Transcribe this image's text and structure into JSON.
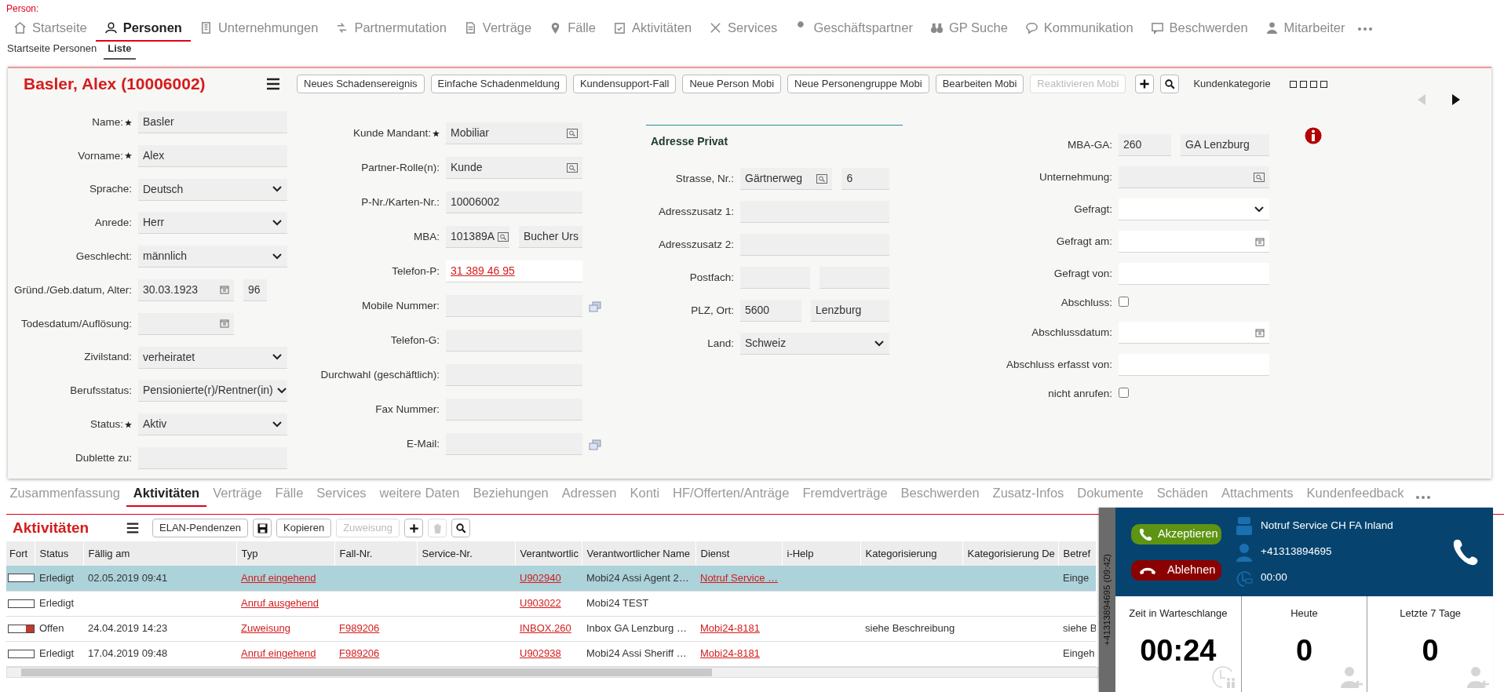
{
  "header": {
    "label": "Person:"
  },
  "main_nav": [
    {
      "label": "Startseite",
      "selected": false
    },
    {
      "label": "Personen",
      "selected": true
    },
    {
      "label": "Unternehmungen",
      "selected": false
    },
    {
      "label": "Partnermutation",
      "selected": false
    },
    {
      "label": "Verträge",
      "selected": false
    },
    {
      "label": "Fälle",
      "selected": false
    },
    {
      "label": "Aktivitäten",
      "selected": false
    },
    {
      "label": "Services",
      "selected": false
    },
    {
      "label": "Geschäftspartner",
      "selected": false
    },
    {
      "label": "GP Suche",
      "selected": false
    },
    {
      "label": "Kommunikation",
      "selected": false
    },
    {
      "label": "Beschwerden",
      "selected": false
    },
    {
      "label": "Mitarbeiter",
      "selected": false
    }
  ],
  "sub_nav": [
    {
      "label": "Startseite Personen",
      "selected": false
    },
    {
      "label": "Liste",
      "selected": true
    }
  ],
  "person": {
    "title": "Basler, Alex (10006002)",
    "actions": [
      {
        "label": "Neues Schadensereignis",
        "disabled": false
      },
      {
        "label": "Einfache Schadenmeldung",
        "disabled": false
      },
      {
        "label": "Kundensupport-Fall",
        "disabled": false
      },
      {
        "label": "Neue Person Mobi",
        "disabled": false
      },
      {
        "label": "Neue Personengruppe Mobi",
        "disabled": false
      },
      {
        "label": "Bearbeiten Mobi",
        "disabled": false
      },
      {
        "label": "Reaktivieren Mobi",
        "disabled": true
      }
    ],
    "kundenkategorie": {
      "label": "Kundenkategorie",
      "stars": 0
    },
    "pager": {
      "prev_disabled": true,
      "next_disabled": false
    }
  },
  "form_columns": [
    {
      "fields": [
        {
          "label": "Name:",
          "required": true,
          "kind": "text",
          "value": "Basler",
          "editable": false
        },
        {
          "label": "Vorname:",
          "required": true,
          "kind": "text",
          "value": "Alex",
          "editable": false
        },
        {
          "label": "Sprache:",
          "required": false,
          "kind": "select",
          "value": "Deutsch",
          "editable": false
        },
        {
          "label": "Anrede:",
          "required": false,
          "kind": "select",
          "value": "Herr",
          "editable": false
        },
        {
          "label": "Geschlecht:",
          "required": false,
          "kind": "select",
          "value": "männlich",
          "editable": false
        },
        {
          "label": "Gründ./Geb.datum, Alter:",
          "required": false,
          "kind": "date",
          "value": "30.03.1923",
          "extra": "96",
          "editable": false
        },
        {
          "label": "Todesdatum/Auflösung:",
          "required": false,
          "kind": "date",
          "editable": false
        },
        {
          "label": "Zivilstand:",
          "required": false,
          "kind": "select",
          "value": "verheiratet",
          "editable": false
        },
        {
          "label": "Berufsstatus:",
          "required": false,
          "kind": "select",
          "value": "Pensionierte(r)/Rentner(in)",
          "editable": false
        },
        {
          "label": "Status:",
          "required": true,
          "kind": "select",
          "value": "Aktiv",
          "editable": false
        },
        {
          "label": "Dublette zu:",
          "required": false,
          "kind": "text",
          "editable": false
        }
      ]
    },
    {
      "fields": [
        {
          "label": "Kunde Mandant:",
          "required": true,
          "kind": "lookup",
          "value": "Mobiliar",
          "editable": false
        },
        {
          "label": "Partner-Rolle(n):",
          "required": false,
          "kind": "lookup",
          "value": "Kunde",
          "editable": false
        },
        {
          "label": "P-Nr./Karten-Nr.:",
          "required": false,
          "kind": "text",
          "value": "10006002",
          "editable": false
        },
        {
          "label": "MBA:",
          "required": false,
          "kind": "lookup_pair",
          "value": "101389A",
          "extra": "Bucher Urs",
          "editable": false
        },
        {
          "label": "Telefon-P:",
          "required": false,
          "kind": "link",
          "value": "31 389 46 95",
          "editable": true
        },
        {
          "label": "Mobile Nummer:",
          "required": false,
          "kind": "text",
          "side_icon": true,
          "editable": false
        },
        {
          "label": "Telefon-G:",
          "required": false,
          "kind": "text",
          "editable": false
        },
        {
          "label": "Durchwahl (geschäftlich):",
          "required": false,
          "kind": "text",
          "editable": false
        },
        {
          "label": "Fax Nummer:",
          "required": false,
          "kind": "text",
          "editable": false
        },
        {
          "label": "E-Mail:",
          "required": false,
          "kind": "text",
          "side_icon": true,
          "editable": false
        }
      ]
    },
    {
      "title": "Adresse Privat",
      "fields": [
        {
          "label": "Strasse, Nr.:",
          "required": false,
          "kind": "lookup_pair",
          "value": "Gärtnerweg",
          "extra": "6",
          "editable": false
        },
        {
          "label": "Adresszusatz 1:",
          "required": false,
          "kind": "text",
          "editable": false
        },
        {
          "label": "Adresszusatz 2:",
          "required": false,
          "kind": "text",
          "editable": false
        },
        {
          "label": "Postfach:",
          "required": false,
          "kind": "pair",
          "editable": false
        },
        {
          "label": "PLZ, Ort:",
          "required": false,
          "kind": "pair",
          "value": "5600",
          "extra": "Lenzburg",
          "editable": false
        },
        {
          "label": "Land:",
          "required": false,
          "kind": "select",
          "value": "Schweiz",
          "editable": false
        }
      ]
    },
    {
      "fields": [
        {
          "label": "MBA-GA:",
          "required": false,
          "kind": "pair",
          "value": "260",
          "extra": "GA Lenzburg",
          "editable": false
        },
        {
          "label": "Unternehmung:",
          "required": false,
          "kind": "lookup",
          "editable": false
        },
        {
          "label": "Gefragt:",
          "required": false,
          "kind": "select",
          "editable": true
        },
        {
          "label": "Gefragt am:",
          "required": false,
          "kind": "date",
          "editable": true
        },
        {
          "label": "Gefragt von:",
          "required": false,
          "kind": "text",
          "editable": true
        },
        {
          "label": "Abschluss:",
          "required": false,
          "kind": "checkbox",
          "checked": false
        },
        {
          "label": "Abschlussdatum:",
          "required": false,
          "kind": "date",
          "editable": true
        },
        {
          "label": "Abschluss erfasst von:",
          "required": false,
          "kind": "text",
          "editable": true
        },
        {
          "label": "nicht anrufen:",
          "required": false,
          "kind": "checkbox",
          "checked": false
        }
      ]
    }
  ],
  "detail_tabs": [
    {
      "label": "Zusammenfassung",
      "selected": false
    },
    {
      "label": "Aktivitäten",
      "selected": true
    },
    {
      "label": "Verträge",
      "selected": false
    },
    {
      "label": "Fälle",
      "selected": false
    },
    {
      "label": "Services",
      "selected": false
    },
    {
      "label": "weitere Daten",
      "selected": false
    },
    {
      "label": "Beziehungen",
      "selected": false
    },
    {
      "label": "Adressen",
      "selected": false
    },
    {
      "label": "Konti",
      "selected": false
    },
    {
      "label": "HF/Offerten/Anträge",
      "selected": false
    },
    {
      "label": "Fremdverträge",
      "selected": false
    },
    {
      "label": "Beschwerden",
      "selected": false
    },
    {
      "label": "Zusatz-Infos",
      "selected": false
    },
    {
      "label": "Dokumente",
      "selected": false
    },
    {
      "label": "Schäden",
      "selected": false
    },
    {
      "label": "Attachments",
      "selected": false
    },
    {
      "label": "Kundenfeedback",
      "selected": false
    }
  ],
  "activities": {
    "title": "Aktivitäten",
    "tools": [
      {
        "kind": "text",
        "label": "ELAN-Pendenzen",
        "disabled": false
      },
      {
        "kind": "save",
        "disabled": false
      },
      {
        "kind": "text",
        "label": "Kopieren",
        "disabled": false
      },
      {
        "kind": "text",
        "label": "Zuweisung",
        "disabled": true
      },
      {
        "kind": "add",
        "disabled": false
      },
      {
        "kind": "delete",
        "disabled": true
      },
      {
        "kind": "search",
        "disabled": false
      }
    ],
    "columns": [
      {
        "label": "Fort"
      },
      {
        "label": "Status",
        "link": false
      },
      {
        "label": "Fällig am",
        "link": false
      },
      {
        "label": "Typ",
        "link": true
      },
      {
        "label": "Fall-Nr.",
        "link": true
      },
      {
        "label": "Service-Nr."
      },
      {
        "label": "Verantwortlic",
        "link": true
      },
      {
        "label": "Verantwortlicher Name",
        "link": false
      },
      {
        "label": "Dienst",
        "link": true
      },
      {
        "label": "i-Help"
      },
      {
        "label": "Kategorisierung",
        "link": false
      },
      {
        "label": "Kategorisierung De"
      },
      {
        "label": "Betref",
        "link": false
      }
    ],
    "rows": [
      {
        "selected": true,
        "overdue": false,
        "status": "Erledigt",
        "faellig_am": "02.05.2019 09:41",
        "typ": "Anruf eingehend",
        "verantwortlich": "U902940",
        "verantwortlicher_name": "Mobi24 Assi Agent 2…",
        "dienst": "Notruf Service …",
        "betreff": "Einge"
      },
      {
        "selected": false,
        "overdue": false,
        "status": "Erledigt",
        "typ": "Anruf ausgehend",
        "verantwortlich": "U903022",
        "verantwortlicher_name": "Mobi24 TEST"
      },
      {
        "selected": false,
        "overdue": true,
        "status": "Offen",
        "faellig_am": "24.04.2019 14:23",
        "typ": "Zuweisung",
        "fall_nr": "F989206",
        "verantwortlich": "INBOX.260",
        "verantwortlicher_name": "Inbox GA Lenzburg …",
        "dienst": "Mobi24-8181",
        "kategorisierung": "siehe Beschreibung",
        "betreff": "siehe B"
      },
      {
        "selected": false,
        "overdue": false,
        "status": "Erledigt",
        "faellig_am": "17.04.2019 09:48",
        "typ": "Anruf eingehend",
        "fall_nr": "F989206",
        "verantwortlich": "U902938",
        "verantwortlicher_name": "Mobi24 Assi Sheriff …",
        "dienst": "Mobi24-8181",
        "betreff": "Eingeh"
      }
    ]
  },
  "call": {
    "strip": "+41313894695 (09:42)",
    "accept": "Akzeptieren",
    "reject": "Ablehnen",
    "service": "Notruf Service CH FA Inland",
    "number": "+41313894695",
    "duration": "00:00",
    "stats": [
      {
        "label": "Zeit in Warteschlange",
        "value": "00:24"
      },
      {
        "label": "Heute",
        "value": "0"
      },
      {
        "label": "Letzte 7 Tage",
        "value": "0"
      }
    ]
  }
}
